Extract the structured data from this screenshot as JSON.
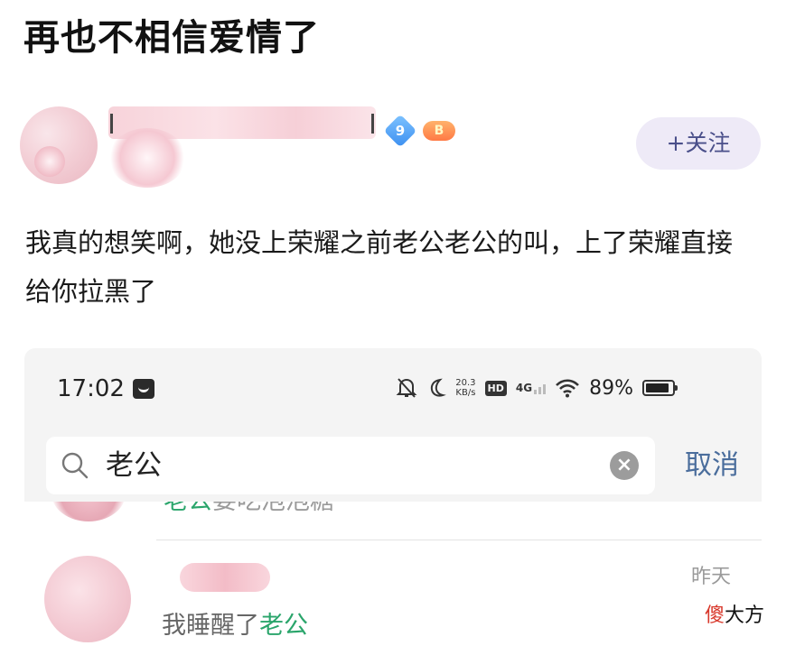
{
  "post": {
    "title": "再也不相信爱情了",
    "follow_label": "+关注",
    "level_badge": "9",
    "game_badge": "B",
    "body": "我真的想笑啊，她没上荣耀之前老公老公的叫，上了荣耀直接给你拉黑了"
  },
  "phone": {
    "status_bar": {
      "time": "17:02",
      "net_speed_value": "20.3",
      "net_speed_unit": "KB/s",
      "hd_label": "HD",
      "signal_label": "4G",
      "battery_pct": "89%",
      "battery_level": 0.89
    },
    "search": {
      "query": "老公",
      "clear_symbol": "×",
      "cancel_label": "取消"
    },
    "results": {
      "prev_row_highlight": "老公",
      "prev_row_rest": "要吃泡泡糖",
      "chat_time": "昨天",
      "chat_preview_prefix": "我睡醒了",
      "chat_preview_highlight": "老公"
    }
  },
  "watermark": {
    "red_char": "傻",
    "rest": "大方"
  },
  "colors": {
    "follow_bg": "#eeeaf7",
    "follow_text": "#4a4f8a",
    "cancel_text": "#4a6d9c",
    "highlight_green": "#2aa56b",
    "watermark_red": "#d8372a"
  }
}
